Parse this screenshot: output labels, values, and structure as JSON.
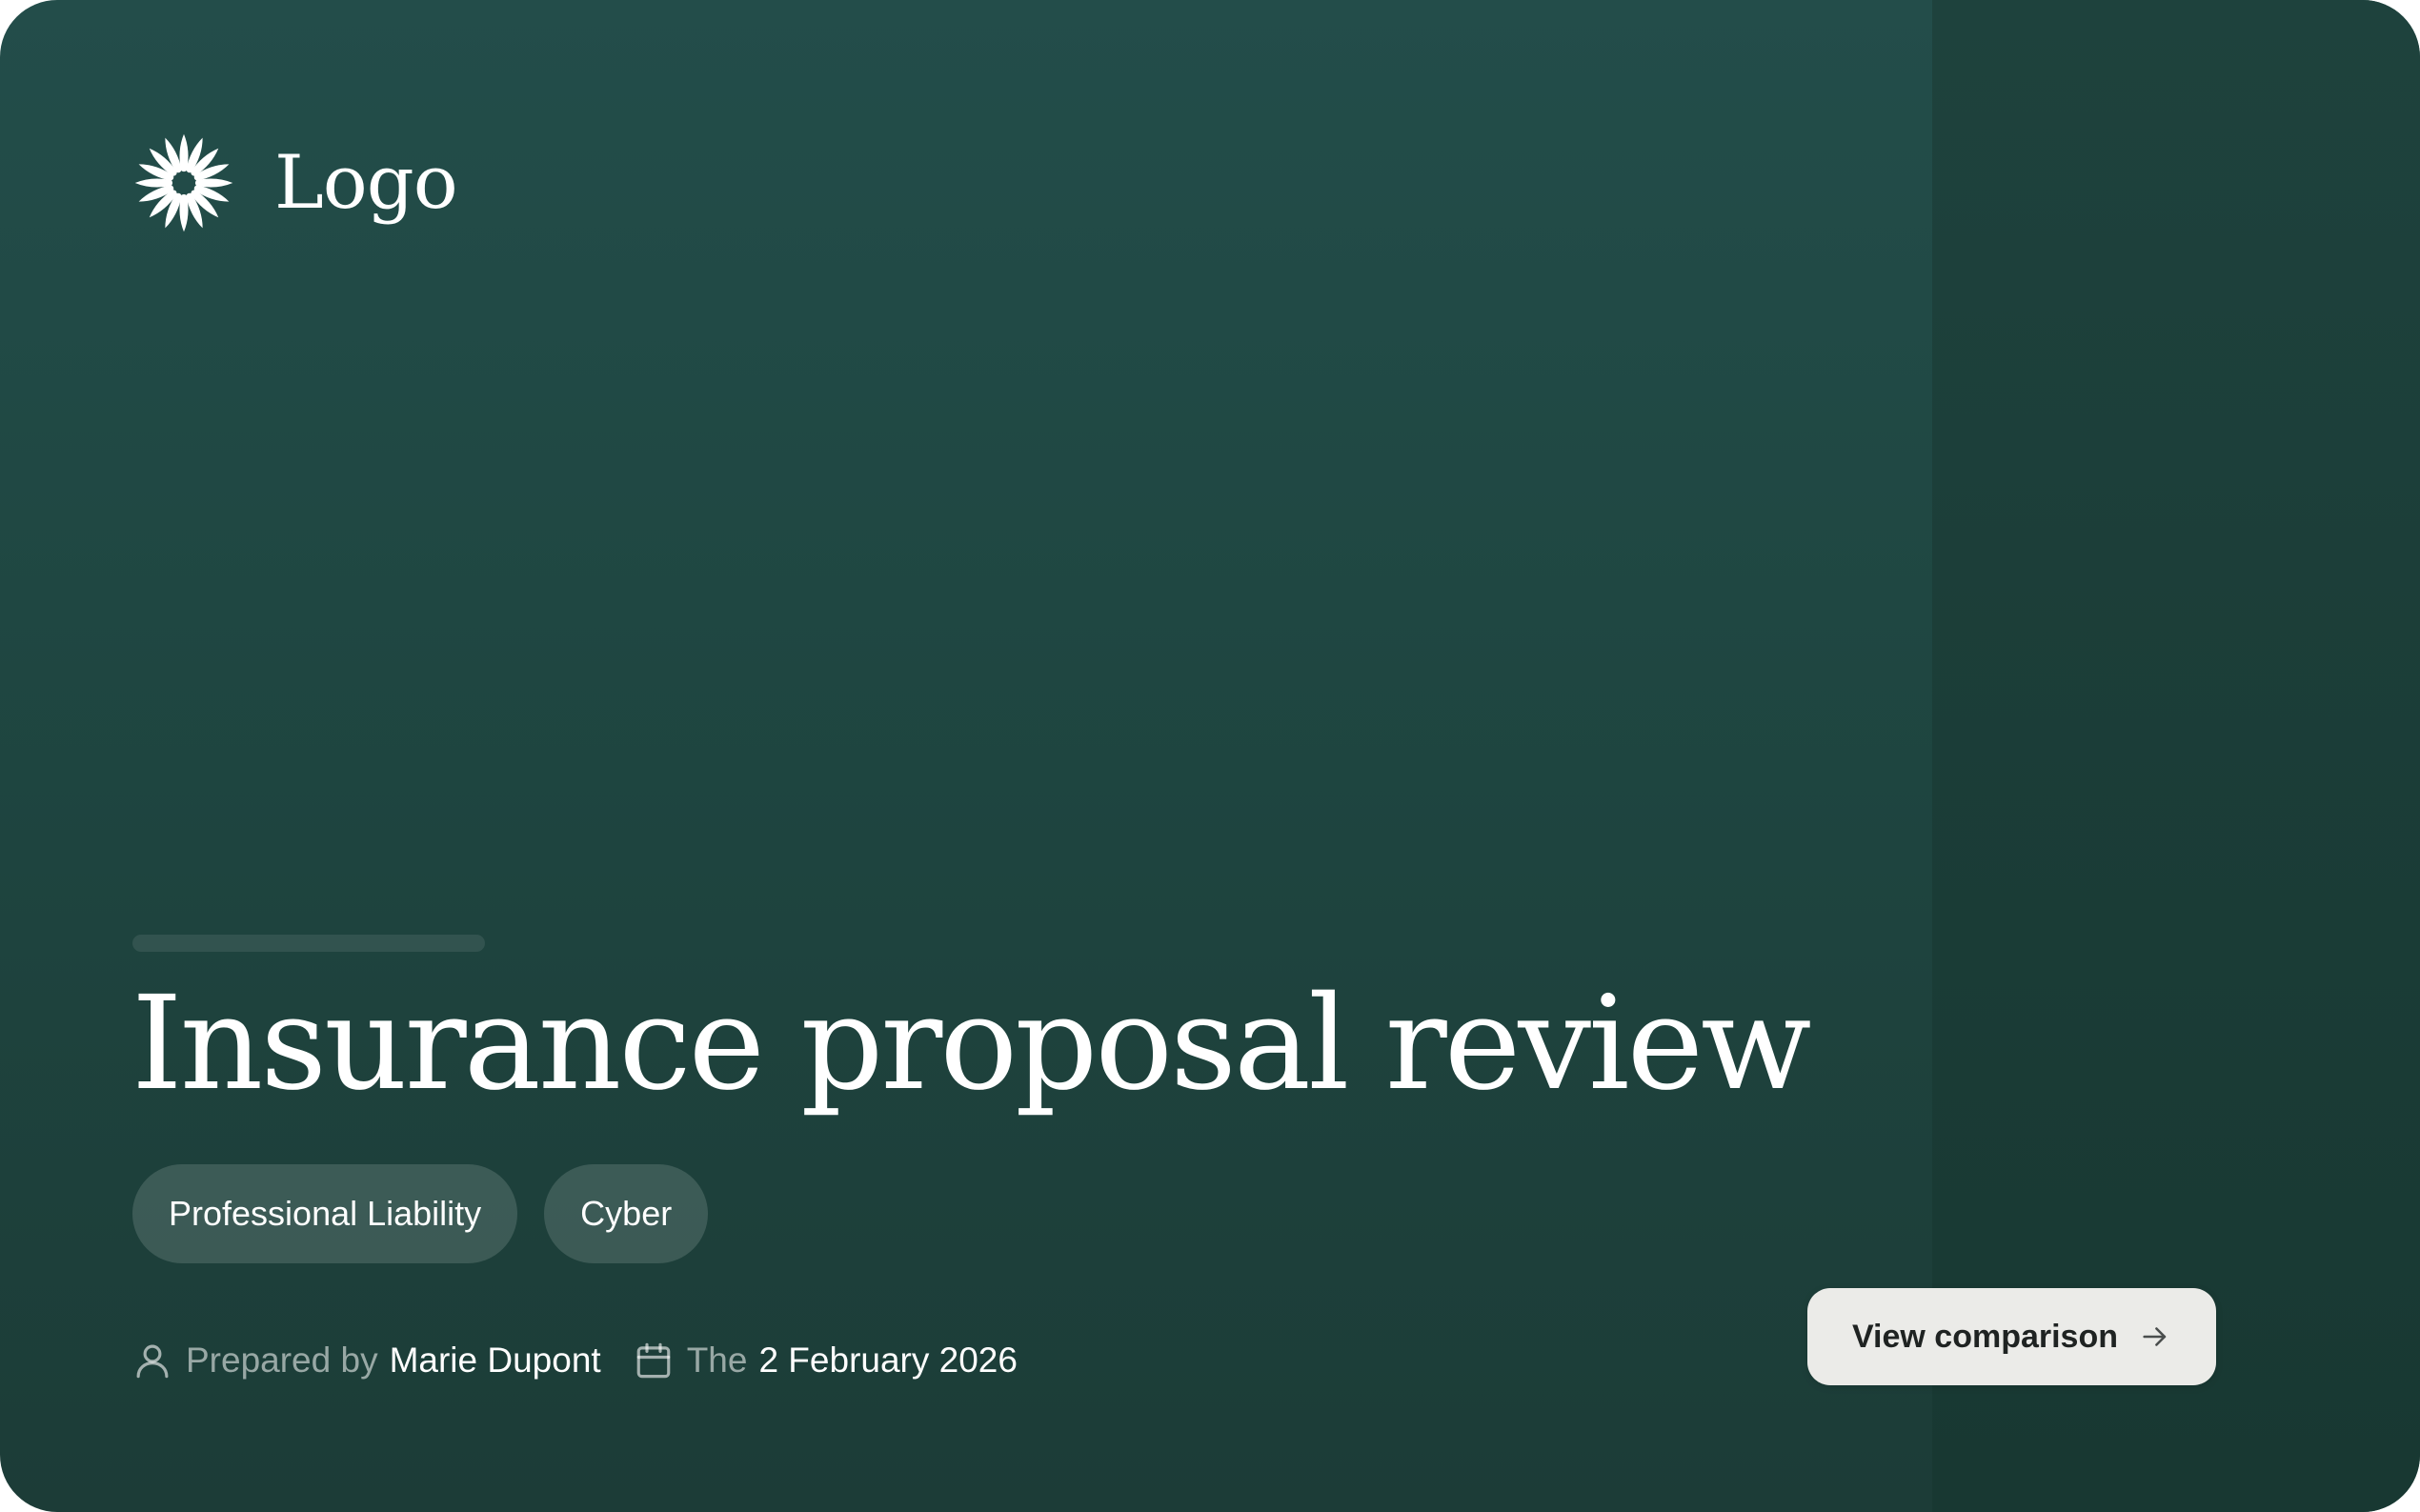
{
  "brand": {
    "logo_text": "Logo",
    "logo_icon": "sunburst-logo-icon"
  },
  "hero": {
    "title": "Insurance proposal review",
    "tags": [
      "Professional Liability",
      "Cyber"
    ]
  },
  "meta": {
    "prepared_prefix": "Prepared by",
    "prepared_by": "Marie Dupont",
    "date_prefix": "The",
    "date": "2 February 2026",
    "user_icon": "user-icon",
    "calendar_icon": "calendar-icon"
  },
  "actions": {
    "view_comparison_label": "View comparison",
    "arrow_icon": "arrow-right-icon"
  },
  "colors": {
    "background": "#214a45",
    "side_panel": "#1b3b36",
    "button": "#ebebe8",
    "text": "#ffffff"
  }
}
